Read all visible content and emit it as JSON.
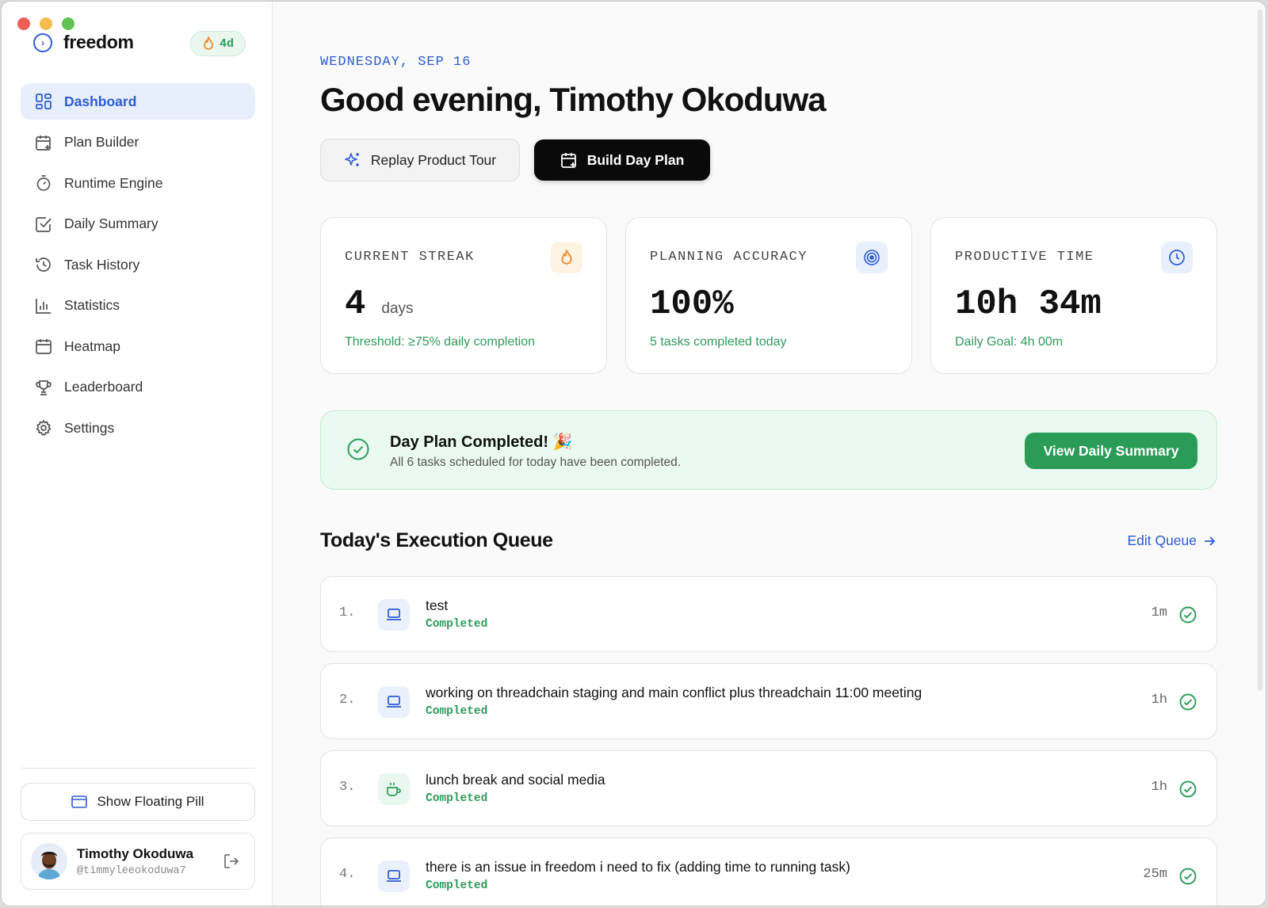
{
  "app": {
    "name": "freedom",
    "streak_badge": "4d"
  },
  "sidebar": {
    "items": [
      {
        "label": "Dashboard",
        "icon": "dashboard-grid-icon",
        "active": true
      },
      {
        "label": "Plan Builder",
        "icon": "calendar-plus-icon"
      },
      {
        "label": "Runtime Engine",
        "icon": "timer-icon"
      },
      {
        "label": "Daily Summary",
        "icon": "checkbox-icon"
      },
      {
        "label": "Task History",
        "icon": "history-icon"
      },
      {
        "label": "Statistics",
        "icon": "bar-chart-icon"
      },
      {
        "label": "Heatmap",
        "icon": "calendar-icon"
      },
      {
        "label": "Leaderboard",
        "icon": "trophy-icon"
      },
      {
        "label": "Settings",
        "icon": "gear-icon"
      }
    ],
    "floating_pill_label": "Show Floating Pill",
    "user": {
      "name": "Timothy Okoduwa",
      "handle": "@timmyleeokoduwa7"
    }
  },
  "header": {
    "date": "WEDNESDAY, SEP 16",
    "greeting": "Good evening, Timothy Okoduwa",
    "tour_button": "Replay Product Tour",
    "build_button": "Build Day Plan"
  },
  "stats": [
    {
      "label": "CURRENT STREAK",
      "value": "4",
      "unit": "days",
      "sub": "Threshold: ≥75% daily completion",
      "icon": "flame-icon",
      "color": "#f08c2e"
    },
    {
      "label": "PLANNING ACCURACY",
      "value": "100%",
      "unit": "",
      "sub": "5 tasks completed today",
      "icon": "target-icon",
      "color": "#2d5bd6"
    },
    {
      "label": "PRODUCTIVE TIME",
      "value": "10h 34m",
      "unit": "",
      "sub": "Daily Goal: 4h 00m",
      "icon": "clock-icon",
      "color": "#2d5bd6"
    }
  ],
  "banner": {
    "title": "Day Plan Completed! 🎉",
    "subtitle": "All 6 tasks scheduled for today have been completed.",
    "button": "View Daily Summary"
  },
  "queue": {
    "title": "Today's Execution Queue",
    "edit_label": "Edit Queue",
    "tasks": [
      {
        "num": "1.",
        "name": "test",
        "status": "Completed",
        "duration": "1m",
        "icon": "laptop-icon"
      },
      {
        "num": "2.",
        "name": "working on threadchain staging and main conflict plus threadchain 11:00 meeting",
        "status": "Completed",
        "duration": "1h",
        "icon": "laptop-icon"
      },
      {
        "num": "3.",
        "name": "lunch break and social media",
        "status": "Completed",
        "duration": "1h",
        "icon": "coffee-icon"
      },
      {
        "num": "4.",
        "name": "there is an issue in freedom i need to fix (adding time to running task)",
        "status": "Completed",
        "duration": "25m",
        "icon": "laptop-icon"
      }
    ]
  },
  "colors": {
    "accent": "#2d5bd6",
    "success": "#2a9c58",
    "streak": "#f08c2e"
  }
}
